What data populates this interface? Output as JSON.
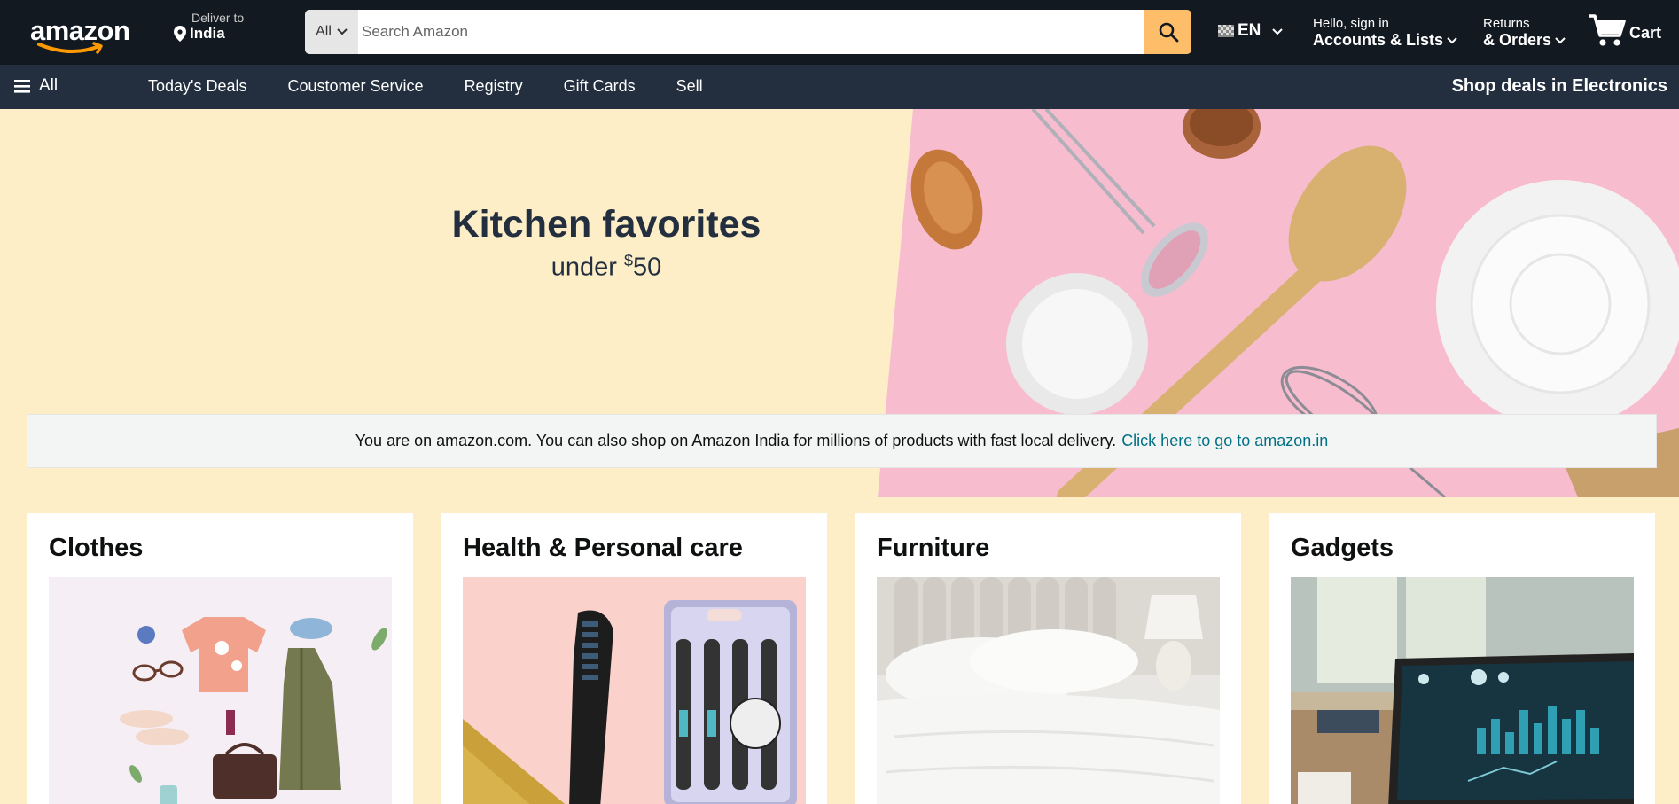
{
  "header": {
    "logo_text": "amazon",
    "deliver_label": "Deliver to",
    "deliver_location": "India",
    "search": {
      "category": "All",
      "placeholder": "Search Amazon"
    },
    "language": "EN",
    "account": {
      "greeting": "Hello, sign in",
      "label": "Accounts & Lists"
    },
    "orders": {
      "top": "Returns",
      "label": "& Orders"
    },
    "cart_label": "Cart"
  },
  "subnav": {
    "all_label": "All",
    "links": [
      "Today's Deals",
      "Coustomer Service",
      "Registry",
      "Gift Cards",
      "Sell"
    ],
    "promo": "Shop deals in Electronics"
  },
  "hero": {
    "title": "Kitchen favorites",
    "subtitle_prefix": "under ",
    "subtitle_currency": "$",
    "subtitle_amount": "50"
  },
  "notice": {
    "text": "You are on amazon.com. You can also shop on Amazon India for millions of products with fast local delivery.",
    "link": "Click here to go to amazon.in"
  },
  "cards": [
    {
      "title": "Clothes"
    },
    {
      "title": "Health & Personal care"
    },
    {
      "title": "Furniture"
    },
    {
      "title": "Gadgets"
    }
  ],
  "colors": {
    "nav_dark": "#131921",
    "subnav": "#232f3e",
    "search_button": "#febd69",
    "logo_smile": "#ff9900",
    "hero_bg": "#fdeec8",
    "link": "#007185"
  }
}
